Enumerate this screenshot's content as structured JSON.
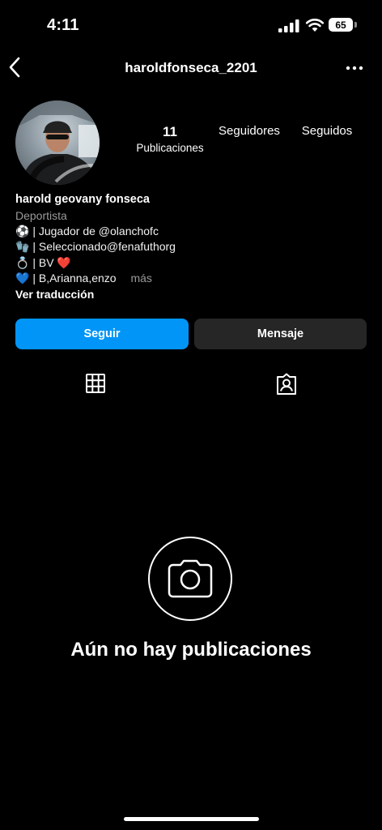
{
  "status_bar": {
    "time": "4:11",
    "battery_level": "65"
  },
  "header": {
    "username": "haroldfonseca_2201",
    "back_icon": "chevron-left-icon",
    "more_icon": "more-horizontal-icon"
  },
  "profile": {
    "stats": {
      "posts_count": "11",
      "posts_label": "Publicaciones",
      "followers_label": "Seguidores",
      "following_label": "Seguidos"
    },
    "full_name": "harold geovany fonseca",
    "category": "Deportista",
    "bio": [
      {
        "emoji": "⚽️",
        "text": "| Jugador de @olanchofc"
      },
      {
        "emoji": "🧤",
        "text": "| Seleccionado@fenafuthorg"
      },
      {
        "emoji": "💍",
        "text": "| BV ❤️"
      },
      {
        "emoji": "💙",
        "text": "| B,Arianna,enzo"
      }
    ],
    "more_label": "más",
    "translate_label": "Ver traducción"
  },
  "actions": {
    "follow_label": "Seguir",
    "message_label": "Mensaje",
    "follow_color": "#0095f6",
    "message_color": "#262626"
  },
  "tabs": [
    {
      "icon": "grid-icon"
    },
    {
      "icon": "tagged-person-icon"
    }
  ],
  "empty_state": {
    "icon": "camera-icon",
    "text": "Aún no hay publicaciones"
  }
}
